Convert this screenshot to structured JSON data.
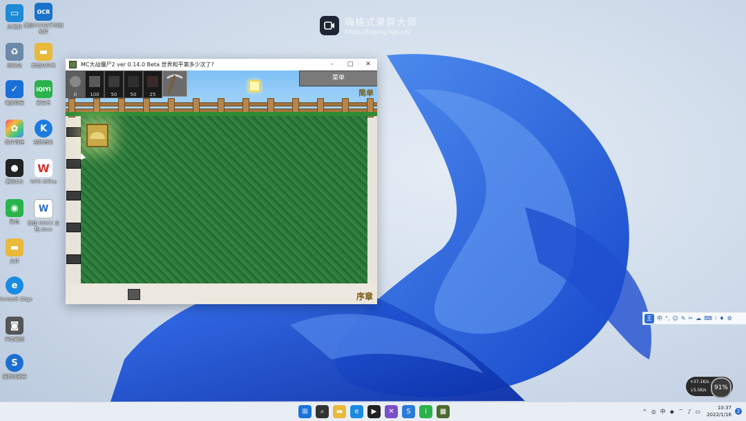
{
  "desktop": {
    "icons": [
      {
        "label": "此电脑",
        "color": "#1f8ad6"
      },
      {
        "label": "捕捉OCR文字识别软件",
        "color": "#1a73c9"
      },
      {
        "label": "回收站",
        "color": "#6c8aa8"
      },
      {
        "label": "新建文件夹",
        "color": "#e8b93a"
      },
      {
        "label": "电脑管家",
        "color": "#1a6fd8"
      },
      {
        "label": "爱奇艺",
        "color": "#2bb24c"
      },
      {
        "label": "软件管理",
        "color": "#e94e77"
      },
      {
        "label": "酷狗音乐",
        "color": "#1b7be0"
      },
      {
        "label": "腾讯QQ",
        "color": "#222222"
      },
      {
        "label": "WPS Office",
        "color": "#d8322e"
      },
      {
        "label": "微信",
        "color": "#2ab34a"
      },
      {
        "label": "新建 DOCX 文档.docx",
        "color": "#2e6ec4"
      },
      {
        "label": "文件",
        "color": "#e8b93a"
      },
      {
        "label": "Microsoft Edge",
        "color": "#1a8be0"
      },
      {
        "label": "开始截图",
        "color": "#555555"
      },
      {
        "label": "搜狗浏览器",
        "color": "#1b6fd4"
      }
    ]
  },
  "watermark": {
    "title": "嗨格式录屏大师",
    "url": "https://luping.hgs.cn/"
  },
  "window": {
    "title": "MC大战僵尸2 ver 0.14.0 Beta 世界和平第多少次了?",
    "minimize": "–",
    "maximize": "□",
    "close": "✕"
  },
  "game": {
    "slots": [
      {
        "cost": "0"
      },
      {
        "cost": "100"
      },
      {
        "cost": "50"
      },
      {
        "cost": "50"
      },
      {
        "cost": "25"
      }
    ],
    "menu_label": "菜单",
    "difficulty": "简单",
    "level": "序章",
    "cart_count": 5
  },
  "ime": {
    "logo": "王",
    "items": [
      "中",
      "°,",
      "☺",
      "✎",
      "✂",
      "☁",
      "⌨",
      "⁝",
      "♦",
      "⚙"
    ]
  },
  "netmon": {
    "up": "+37.1K/s",
    "down": "↓5.5K/s",
    "percent": "91%"
  },
  "taskbar": {
    "icons": [
      {
        "name": "windows-start-icon",
        "glyph": "⊞",
        "color": "#1a73d9"
      },
      {
        "name": "search-icon",
        "glyph": "⌕",
        "color": "#333333"
      },
      {
        "name": "file-explorer-icon",
        "glyph": "▬",
        "color": "#e8b93a"
      },
      {
        "name": "edge-icon",
        "glyph": "e",
        "color": "#1a8be0"
      },
      {
        "name": "recorder-icon",
        "glyph": "▶",
        "color": "#222222"
      },
      {
        "name": "vs-icon",
        "glyph": "✕",
        "color": "#7b4fc9"
      },
      {
        "name": "sogou-icon",
        "glyph": "S",
        "color": "#2a7ad8"
      },
      {
        "name": "iqiyi-icon",
        "glyph": "i",
        "color": "#2bb24c"
      },
      {
        "name": "game-icon",
        "glyph": "▦",
        "color": "#4a6b2c"
      }
    ],
    "tray_caret": "^",
    "tray_ime": "中",
    "time": "10:37",
    "date": "2022/1/16",
    "notif_count": "2"
  }
}
